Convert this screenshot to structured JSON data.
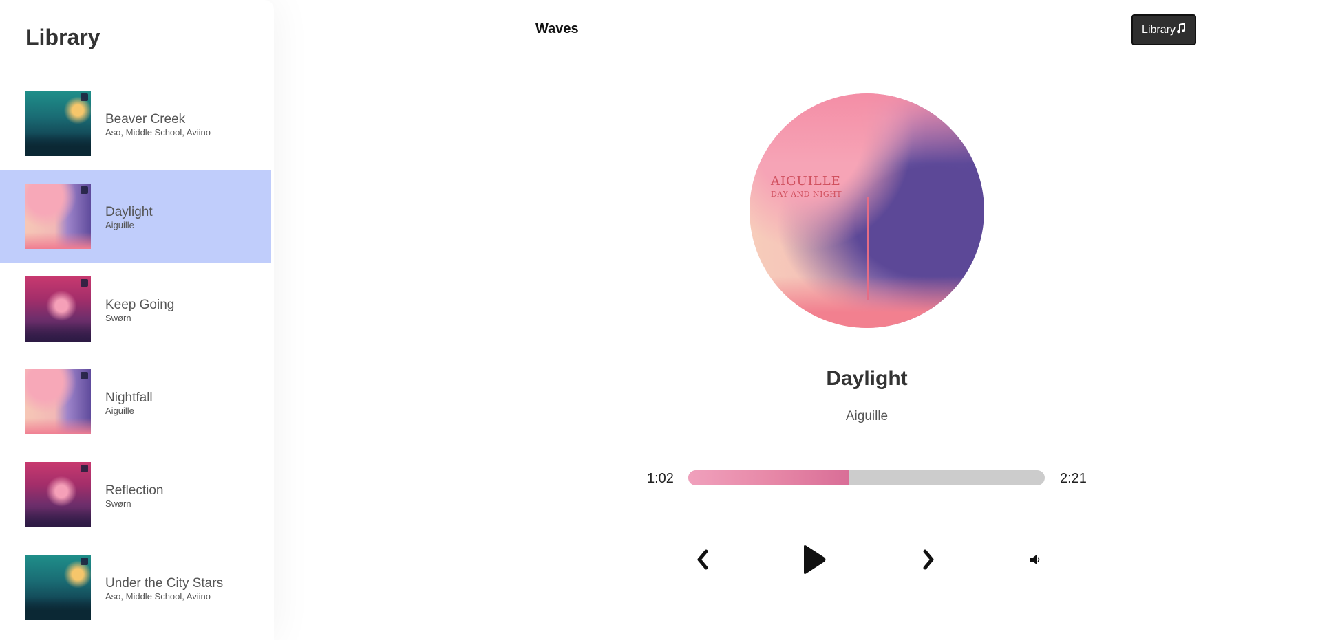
{
  "sidebar": {
    "title": "Library",
    "items": [
      {
        "name": "Beaver Creek",
        "artist": "Aso, Middle School, Aviino",
        "cover_style": "forest",
        "active": false
      },
      {
        "name": "Daylight",
        "artist": "Aiguille",
        "cover_style": "day",
        "active": true
      },
      {
        "name": "Keep Going",
        "artist": "Swørn",
        "cover_style": "dusk",
        "active": false
      },
      {
        "name": "Nightfall",
        "artist": "Aiguille",
        "cover_style": "day",
        "active": false
      },
      {
        "name": "Reflection",
        "artist": "Swørn",
        "cover_style": "dusk",
        "active": false
      },
      {
        "name": "Under the City Stars",
        "artist": "Aso, Middle School, Aviino",
        "cover_style": "forest",
        "active": false
      }
    ]
  },
  "nav": {
    "brand": "Waves",
    "library_button_label": "Library",
    "library_button_icon": "music-note-icon"
  },
  "player": {
    "cover_text_title": "AIGUILLE",
    "cover_text_subtitle": "DAY AND NIGHT",
    "track_title": "Daylight",
    "track_artist": "Aiguille",
    "current_time": "1:02",
    "total_time": "2:21",
    "progress_fraction": 0.45,
    "controls": {
      "prev_icon": "chevron-left-icon",
      "play_icon": "play-icon",
      "next_icon": "chevron-right-icon",
      "volume_icon": "volume-icon"
    }
  },
  "colors": {
    "active_item_bg": "#c0cdfb",
    "progress_fill": "#e789a8",
    "progress_track": "#cccccc",
    "button_bg": "#2f2f2f"
  }
}
